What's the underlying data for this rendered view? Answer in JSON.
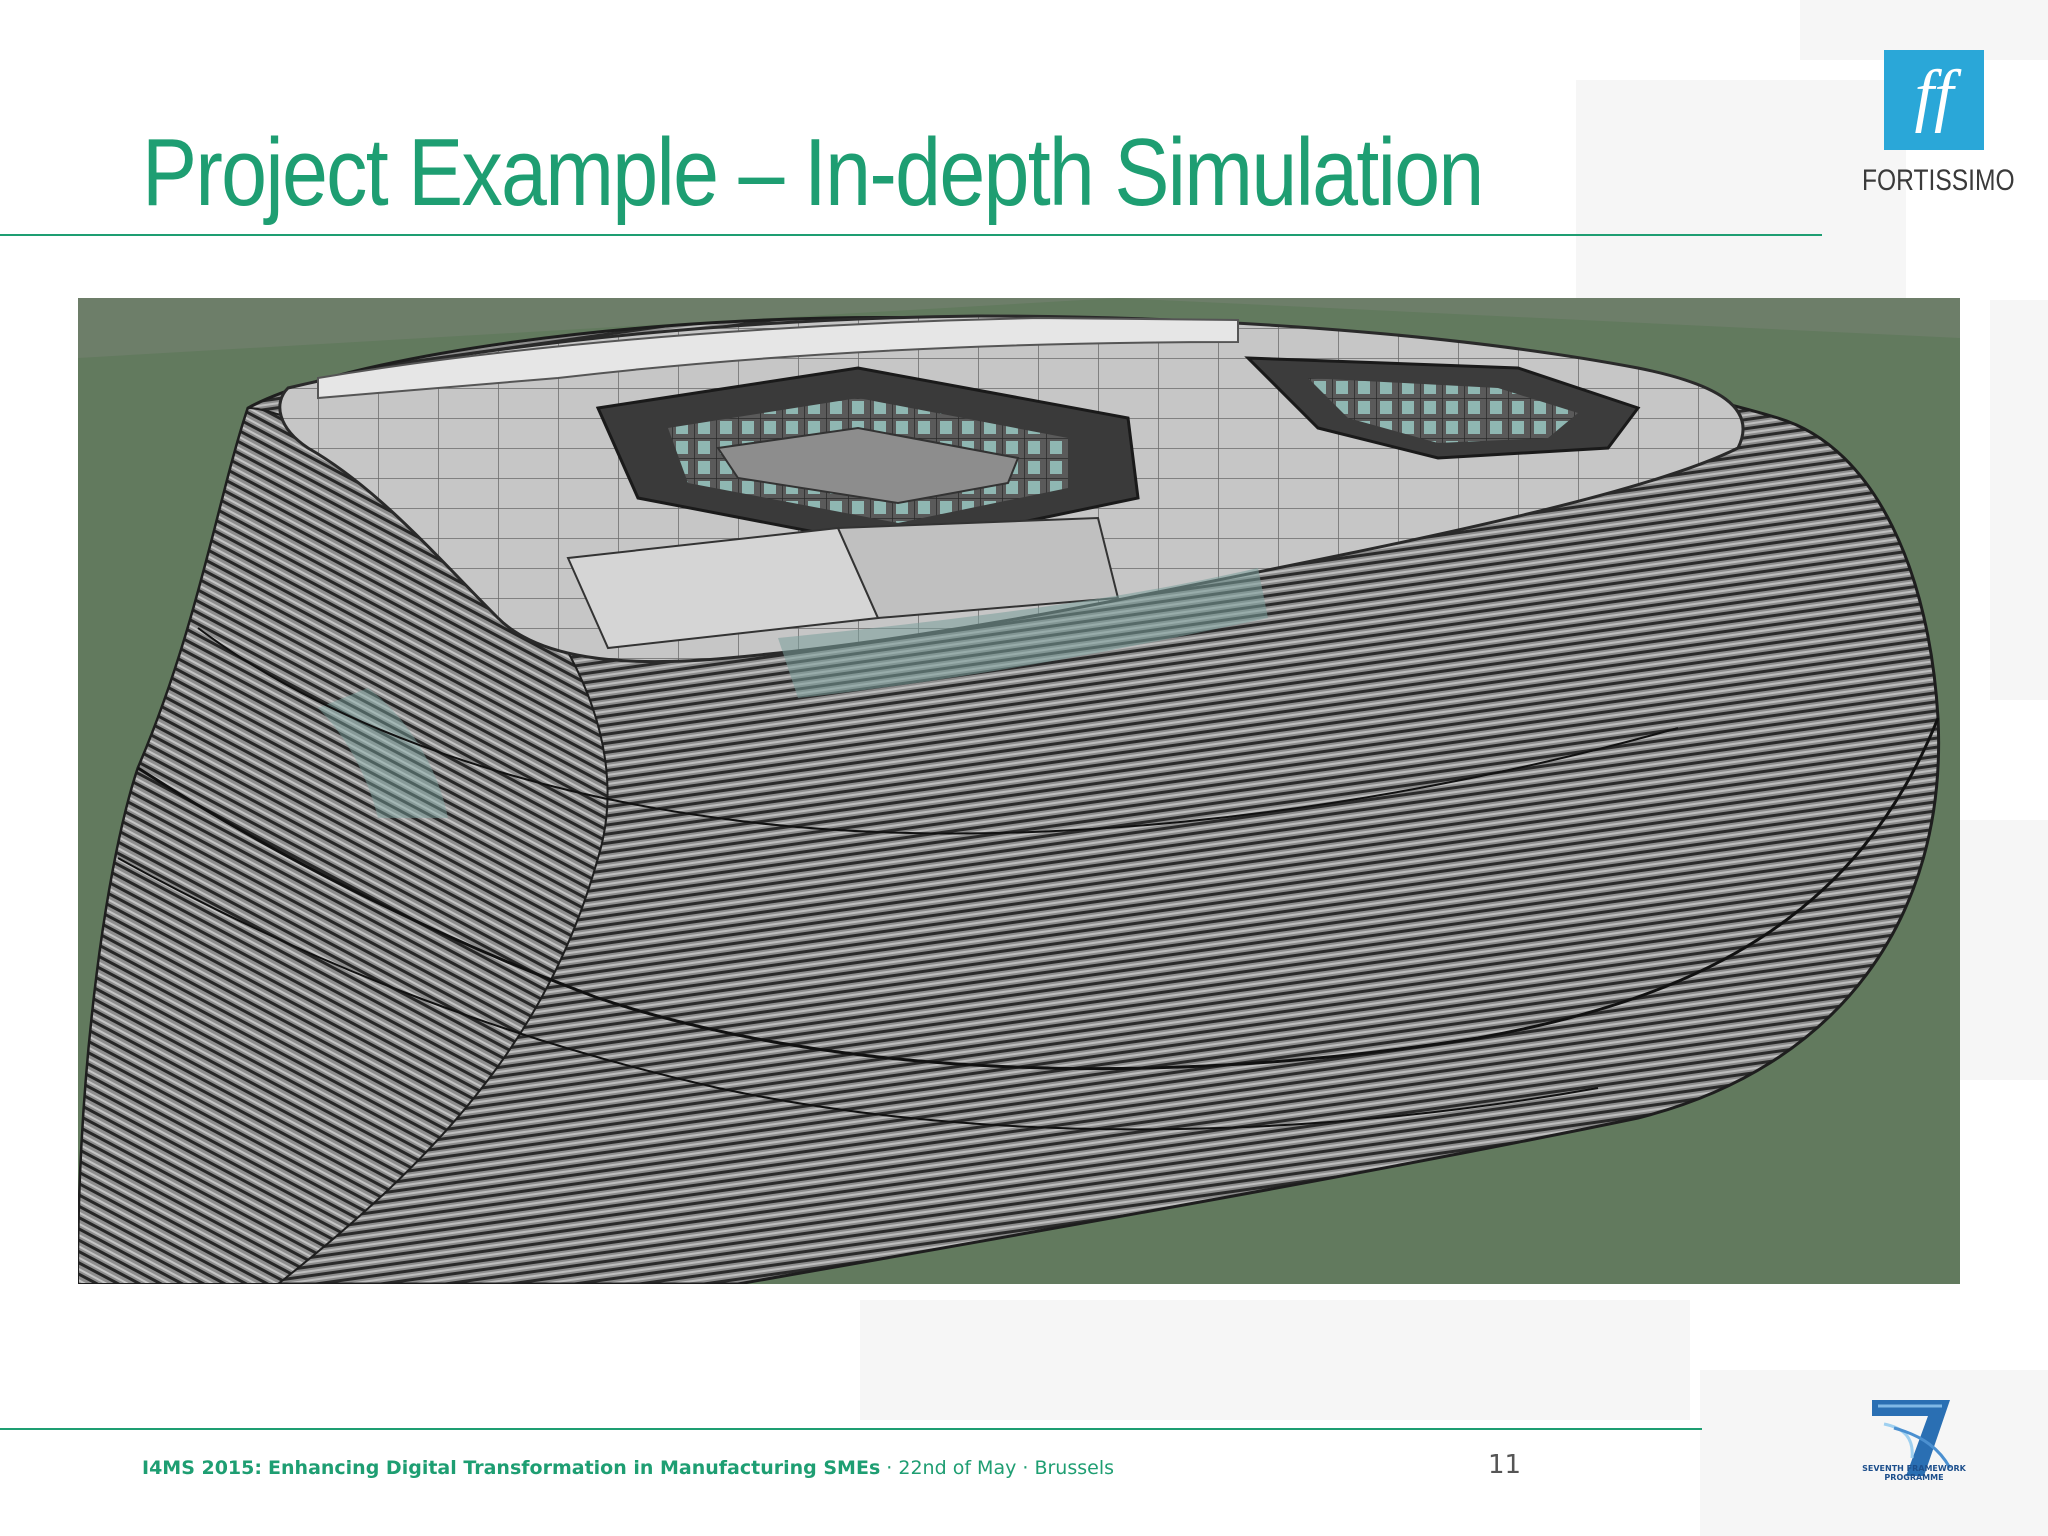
{
  "slide": {
    "title": "Project Example – In-depth Simulation",
    "page_number": "11"
  },
  "logo": {
    "mark": "ff",
    "name": "FORTISSIMO",
    "color": "#2aa7d8"
  },
  "footer": {
    "event": "I4MS 2015:",
    "headline": "Enhancing Digital Transformation in Manufacturing SMEs",
    "details": " · 22nd of May · Brussels",
    "accent_color": "#1e9e72"
  },
  "fp7": {
    "line1": "SEVENTH FRAMEWORK",
    "line2": "PROGRAMME",
    "icon": "fp7-seven-icon"
  },
  "image": {
    "icon": "building-wireframe-render"
  }
}
